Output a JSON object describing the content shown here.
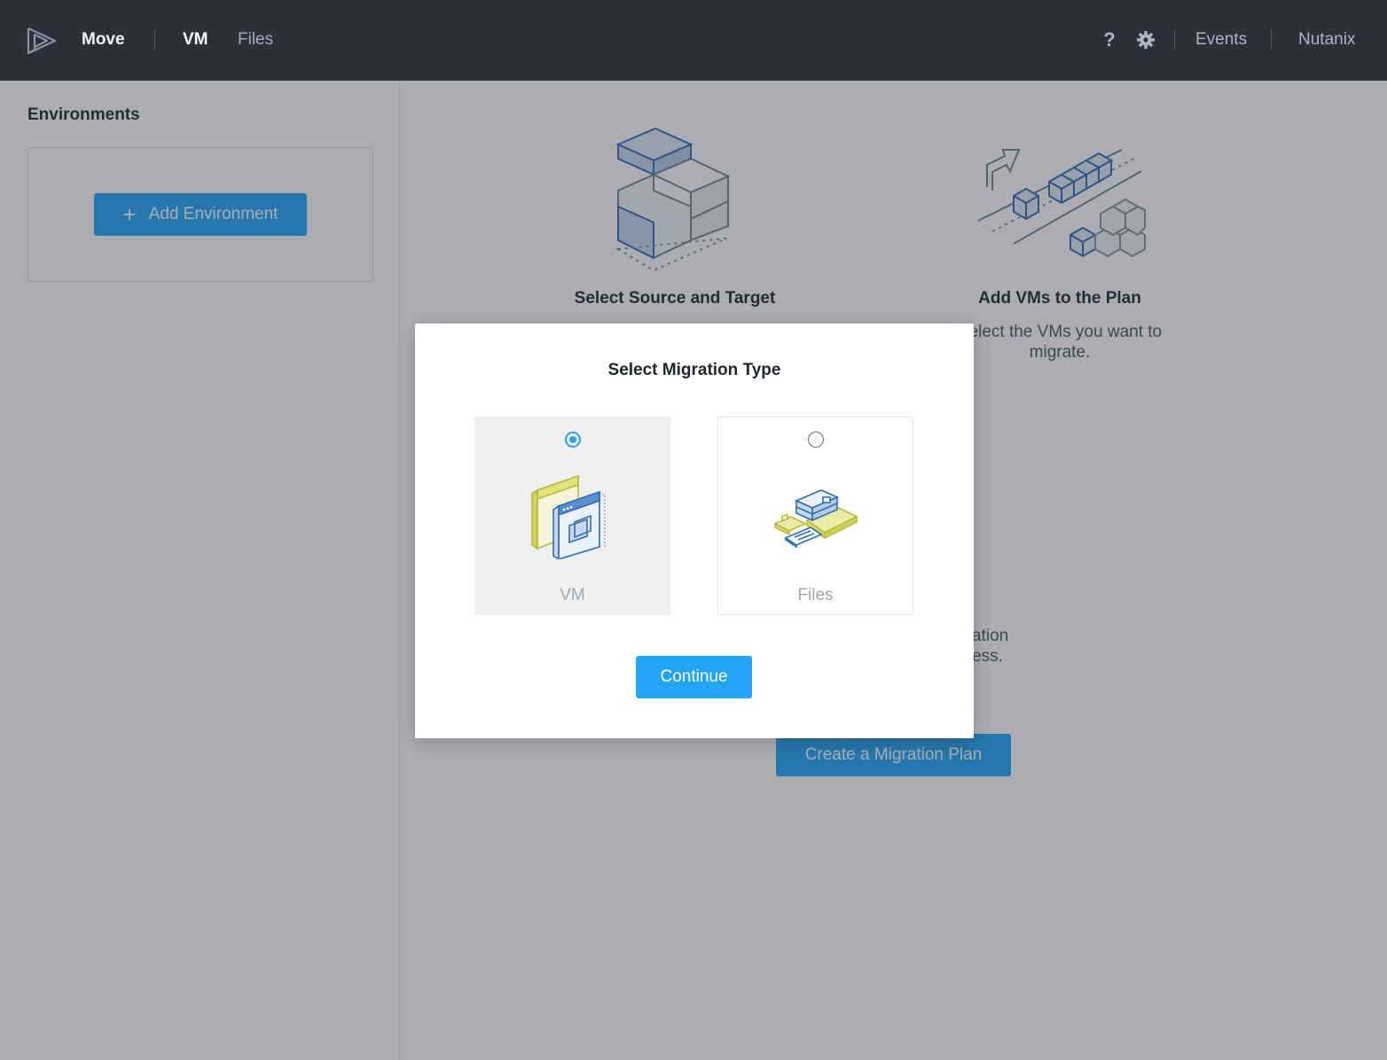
{
  "header": {
    "app_name": "Move",
    "tabs": [
      {
        "label": "VM",
        "active": true
      },
      {
        "label": "Files",
        "active": false
      }
    ],
    "help_label": "?",
    "events_label": "Events",
    "user_label": "Nutanix"
  },
  "sidebar": {
    "title": "Environments",
    "add_button_label": "Add Environment"
  },
  "main": {
    "steps": [
      {
        "title": "Select Source and Target",
        "desc": ""
      },
      {
        "title": "Add VMs to the Plan",
        "desc": "Select the VMs you want to migrate."
      }
    ],
    "partial_text_line1": "ation",
    "partial_text_line2": "ess.",
    "create_plan_label": "Create a Migration Plan"
  },
  "modal": {
    "title": "Select Migration Type",
    "options": [
      {
        "label": "VM",
        "selected": true
      },
      {
        "label": "Files",
        "selected": false
      }
    ],
    "continue_label": "Continue"
  },
  "colors": {
    "accent": "#22a5f7",
    "topbar": "#2b303b",
    "overlay": "rgba(45,50,62,0.40)"
  }
}
